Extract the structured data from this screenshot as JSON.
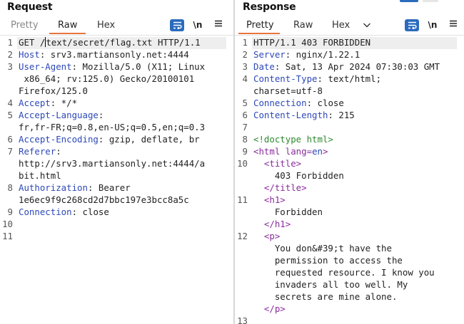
{
  "request": {
    "title": "Request",
    "tabs": [
      "Pretty",
      "Raw",
      "Hex"
    ],
    "active_tab": "Raw",
    "toolbar": {
      "newline_label": "\\n"
    },
    "lines": [
      {
        "n": "1",
        "segs": [
          {
            "t": "GET /",
            "c": ""
          },
          {
            "t": "text/secret/flag.txt HTTP/1.1",
            "c": ""
          }
        ]
      },
      {
        "n": "2",
        "segs": [
          {
            "t": "Host",
            "c": "k"
          },
          {
            "t": ": srv3.martiansonly.net:4444",
            "c": ""
          }
        ]
      },
      {
        "n": "3",
        "segs": [
          {
            "t": "User-Agent",
            "c": "k"
          },
          {
            "t": ": Mozilla/5.0 (X11; Linux",
            "c": ""
          }
        ]
      },
      {
        "n": "",
        "segs": [
          {
            "t": " x86_64; rv:125.0) Gecko/20100101",
            "c": ""
          }
        ]
      },
      {
        "n": "",
        "segs": [
          {
            "t": "Firefox/125.0",
            "c": ""
          }
        ]
      },
      {
        "n": "4",
        "segs": [
          {
            "t": "Accept",
            "c": "k"
          },
          {
            "t": ": */*",
            "c": ""
          }
        ]
      },
      {
        "n": "5",
        "segs": [
          {
            "t": "Accept-Language",
            "c": "k"
          },
          {
            "t": ":",
            "c": ""
          }
        ]
      },
      {
        "n": "",
        "segs": [
          {
            "t": "fr,fr-FR;q=0.8,en-US;q=0.5,en;q=0.3",
            "c": ""
          }
        ]
      },
      {
        "n": "6",
        "segs": [
          {
            "t": "Accept-Encoding",
            "c": "k"
          },
          {
            "t": ": gzip, deflate, br",
            "c": ""
          }
        ]
      },
      {
        "n": "7",
        "segs": [
          {
            "t": "Referer",
            "c": "k"
          },
          {
            "t": ":",
            "c": ""
          }
        ]
      },
      {
        "n": "",
        "segs": [
          {
            "t": "http://srv3.martiansonly.net:4444/a",
            "c": ""
          }
        ]
      },
      {
        "n": "",
        "segs": [
          {
            "t": "bit.html",
            "c": ""
          }
        ]
      },
      {
        "n": "8",
        "segs": [
          {
            "t": "Authorization",
            "c": "k"
          },
          {
            "t": ": Bearer",
            "c": ""
          }
        ]
      },
      {
        "n": "",
        "segs": [
          {
            "t": "1e6ec9f9c268cd2d7bbc197e3bcc8a5c",
            "c": ""
          }
        ]
      },
      {
        "n": "9",
        "segs": [
          {
            "t": "Connection",
            "c": "k"
          },
          {
            "t": ": close",
            "c": ""
          }
        ]
      },
      {
        "n": "10",
        "segs": []
      },
      {
        "n": "11",
        "segs": []
      }
    ]
  },
  "response": {
    "title": "Response",
    "tabs": [
      "Pretty",
      "Raw",
      "Hex"
    ],
    "active_tab": "Pretty",
    "toolbar": {
      "newline_label": "\\n"
    },
    "lines": [
      {
        "n": "1",
        "segs": [
          {
            "t": "HTTP/1.1 403 FORBIDDEN",
            "c": ""
          }
        ]
      },
      {
        "n": "2",
        "segs": [
          {
            "t": "Server",
            "c": "k"
          },
          {
            "t": ": nginx/1.22.1",
            "c": ""
          }
        ]
      },
      {
        "n": "3",
        "segs": [
          {
            "t": "Date",
            "c": "k"
          },
          {
            "t": ": Sat, 13 Apr 2024 07:30:03 GMT",
            "c": ""
          }
        ]
      },
      {
        "n": "4",
        "segs": [
          {
            "t": "Content-Type",
            "c": "k"
          },
          {
            "t": ": text/html;",
            "c": ""
          }
        ]
      },
      {
        "n": "",
        "segs": [
          {
            "t": "charset=utf-8",
            "c": ""
          }
        ]
      },
      {
        "n": "5",
        "segs": [
          {
            "t": "Connection",
            "c": "k"
          },
          {
            "t": ": close",
            "c": ""
          }
        ]
      },
      {
        "n": "6",
        "segs": [
          {
            "t": "Content-Length",
            "c": "k"
          },
          {
            "t": ": 215",
            "c": ""
          }
        ]
      },
      {
        "n": "7",
        "segs": []
      },
      {
        "n": "8",
        "segs": [
          {
            "t": "<!doctype html>",
            "c": "green"
          }
        ]
      },
      {
        "n": "9",
        "segs": [
          {
            "t": "<html ",
            "c": "tag"
          },
          {
            "t": "lang=",
            "c": "attr"
          },
          {
            "t": "en",
            "c": "k"
          },
          {
            "t": ">",
            "c": "tag"
          }
        ]
      },
      {
        "n": "10",
        "segs": [
          {
            "t": "  ",
            "c": ""
          },
          {
            "t": "<title>",
            "c": "tag"
          }
        ]
      },
      {
        "n": "",
        "segs": [
          {
            "t": "    403 Forbidden",
            "c": ""
          }
        ]
      },
      {
        "n": "",
        "segs": [
          {
            "t": "  ",
            "c": ""
          },
          {
            "t": "</title>",
            "c": "tag"
          }
        ]
      },
      {
        "n": "11",
        "segs": [
          {
            "t": "  ",
            "c": ""
          },
          {
            "t": "<h1>",
            "c": "tag"
          }
        ]
      },
      {
        "n": "",
        "segs": [
          {
            "t": "    Forbidden",
            "c": ""
          }
        ]
      },
      {
        "n": "",
        "segs": [
          {
            "t": "  ",
            "c": ""
          },
          {
            "t": "</h1>",
            "c": "tag"
          }
        ]
      },
      {
        "n": "12",
        "segs": [
          {
            "t": "  ",
            "c": ""
          },
          {
            "t": "<p>",
            "c": "tag"
          }
        ]
      },
      {
        "n": "",
        "segs": [
          {
            "t": "    You don&#39;t have the",
            "c": ""
          }
        ]
      },
      {
        "n": "",
        "segs": [
          {
            "t": "    permission to access the",
            "c": ""
          }
        ]
      },
      {
        "n": "",
        "segs": [
          {
            "t": "    requested resource. I know you",
            "c": ""
          }
        ]
      },
      {
        "n": "",
        "segs": [
          {
            "t": "    invaders all too well. My",
            "c": ""
          }
        ]
      },
      {
        "n": "",
        "segs": [
          {
            "t": "    secrets are mine alone.",
            "c": ""
          }
        ]
      },
      {
        "n": "",
        "segs": [
          {
            "t": "  ",
            "c": ""
          },
          {
            "t": "</p>",
            "c": "tag"
          }
        ]
      },
      {
        "n": "13",
        "segs": []
      }
    ]
  },
  "colors": {
    "accent": "#e8743b",
    "key": "#2d48b8",
    "tag": "#8a2b9c",
    "doctype": "#2f8a2f",
    "toolbar_button": "#2b6bbd"
  },
  "icons": [
    "word-wrap-icon",
    "newline-icon",
    "menu-icon",
    "chevron-down-icon"
  ]
}
